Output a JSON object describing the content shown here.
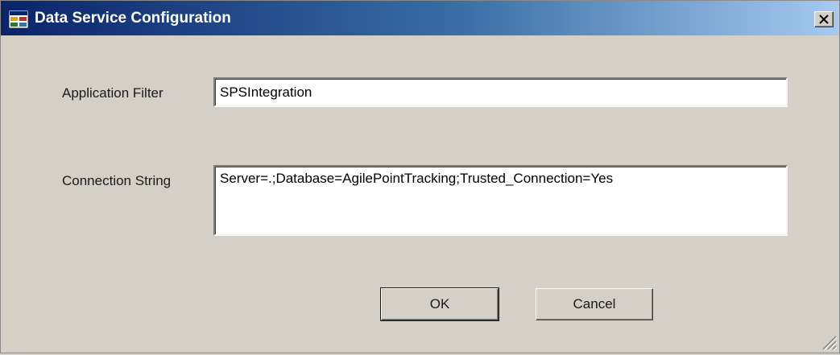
{
  "window": {
    "title": "Data Service Configuration",
    "close_icon": "close-icon",
    "app_icon": "application-icon"
  },
  "form": {
    "application_filter": {
      "label": "Application Filter",
      "value": "SPSIntegration"
    },
    "connection_string": {
      "label": "Connection String",
      "value": "Server=.;Database=AgilePointTracking;Trusted_Connection=Yes"
    }
  },
  "buttons": {
    "ok_label": "OK",
    "cancel_label": "Cancel"
  },
  "colors": {
    "titlebar_start": "#0a246a",
    "titlebar_end": "#a6caf0",
    "dialog_background": "#d4d0c8"
  }
}
